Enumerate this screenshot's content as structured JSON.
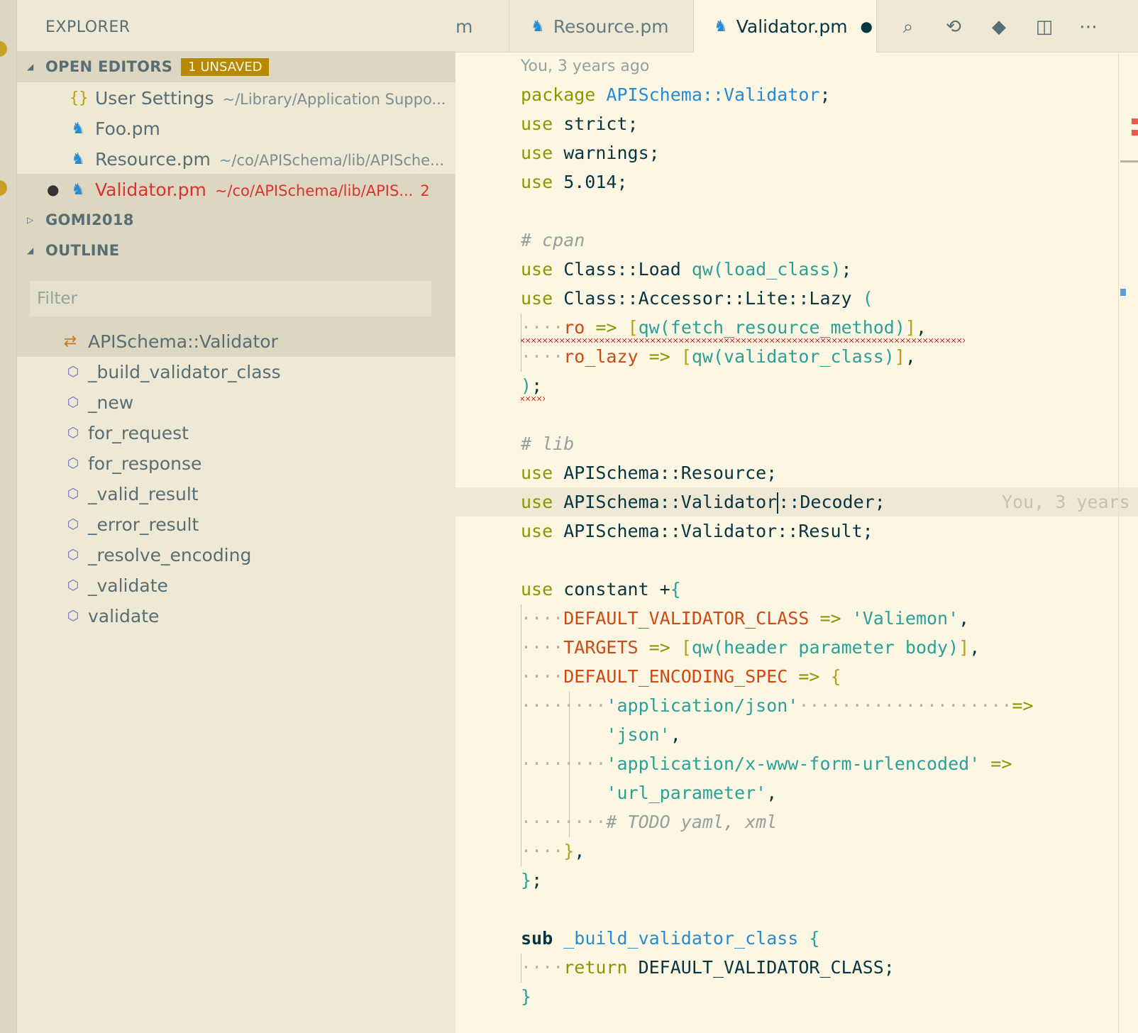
{
  "sidebar": {
    "title": "EXPLORER",
    "open_editors": {
      "label": "OPEN EDITORS",
      "badge": "1 UNSAVED",
      "items": [
        {
          "name": "User Settings",
          "path": "~/Library/Application Suppo...",
          "icon": "braces-icon"
        },
        {
          "name": "Foo.pm",
          "path": "",
          "icon": "camel-icon"
        },
        {
          "name": "Resource.pm",
          "path": "~/co/APISchema/lib/APISche...",
          "icon": "camel-icon"
        },
        {
          "name": "Validator.pm",
          "path": "~/co/APISchema/lib/APIS...",
          "icon": "camel-icon",
          "errors": "2",
          "modified": true
        }
      ]
    },
    "gomi_label": "GOMI2018",
    "outline": {
      "label": "OUTLINE",
      "filter_placeholder": "Filter",
      "items": [
        {
          "name": "APISchema::Validator",
          "kind": "package"
        },
        {
          "name": "_build_validator_class",
          "kind": "method"
        },
        {
          "name": "_new",
          "kind": "method"
        },
        {
          "name": "for_request",
          "kind": "method"
        },
        {
          "name": "for_response",
          "kind": "method"
        },
        {
          "name": "_valid_result",
          "kind": "method"
        },
        {
          "name": "_error_result",
          "kind": "method"
        },
        {
          "name": "_resolve_encoding",
          "kind": "method"
        },
        {
          "name": "_validate",
          "kind": "method"
        },
        {
          "name": "validate",
          "kind": "method"
        }
      ]
    }
  },
  "tabs": [
    {
      "label": "m",
      "active": false
    },
    {
      "label": "Resource.pm",
      "active": false
    },
    {
      "label": "Validator.pm",
      "active": true,
      "modified": true
    }
  ],
  "editor": {
    "codelens": "You, 3 years ago",
    "inline_blame": "You, 3 years",
    "colors": {
      "background": "#fdf6e3",
      "keyword": "#859900",
      "string": "#2aa198",
      "constant": "#cb4b16",
      "namespace": "#268bd2",
      "error": "#dc322f"
    }
  }
}
